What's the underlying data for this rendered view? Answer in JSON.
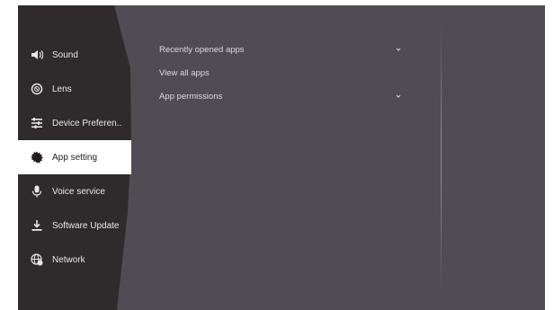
{
  "sidebar": {
    "items": [
      {
        "label": "Sound",
        "icon": "speaker-icon",
        "active": false
      },
      {
        "label": "Lens",
        "icon": "lens-icon",
        "active": false
      },
      {
        "label": "Device Preferen..",
        "icon": "sliders-icon",
        "active": false
      },
      {
        "label": "App setting",
        "icon": "gear-icon",
        "active": true
      },
      {
        "label": "Voice service",
        "icon": "microphone-icon",
        "active": false
      },
      {
        "label": "Software Update",
        "icon": "download-icon",
        "active": false
      },
      {
        "label": "Network",
        "icon": "globe-icon",
        "active": false
      }
    ]
  },
  "main": {
    "rows": [
      {
        "label": "Recently opened apps",
        "expandable": true
      },
      {
        "label": "View all apps",
        "expandable": false
      },
      {
        "label": "App permissions",
        "expandable": true
      }
    ]
  },
  "colors": {
    "background": "#4f4c54",
    "sidebar": "#2f2b2d",
    "active_item": "#ffffff"
  }
}
